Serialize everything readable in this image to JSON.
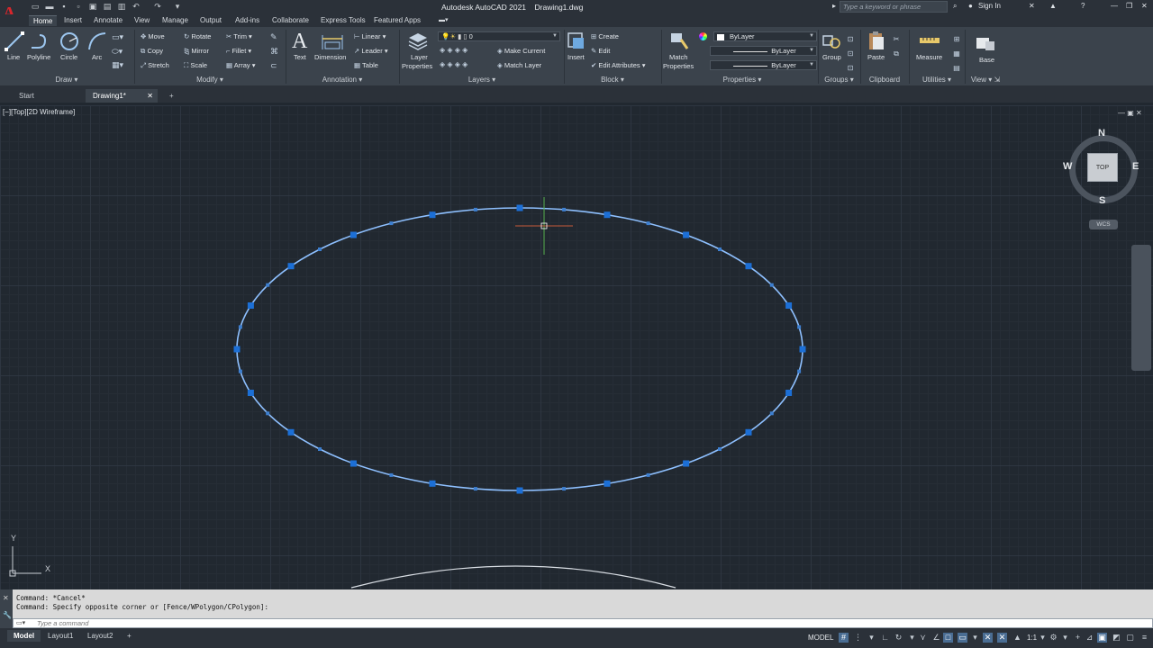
{
  "app": {
    "title": "Autodesk AutoCAD 2021",
    "file": "Drawing1.dwg",
    "logo": "A",
    "search_placeholder": "Type a keyword or phrase",
    "sign_in": "Sign In"
  },
  "ribbon_tabs": [
    "Home",
    "Insert",
    "Annotate",
    "View",
    "Manage",
    "Output",
    "Add-ins",
    "Collaborate",
    "Express Tools",
    "Featured Apps"
  ],
  "draw": {
    "title": "Draw",
    "line": "Line",
    "polyline": "Polyline",
    "circle": "Circle",
    "arc": "Arc"
  },
  "modify": {
    "title": "Modify",
    "move": "Move",
    "rotate": "Rotate",
    "trim": "Trim",
    "copy": "Copy",
    "mirror": "Mirror",
    "fillet": "Fillet",
    "stretch": "Stretch",
    "scale": "Scale",
    "array": "Array"
  },
  "annotation": {
    "title": "Annotation",
    "text": "Text",
    "dimension": "Dimension",
    "linear": "Linear",
    "leader": "Leader",
    "table": "Table"
  },
  "layers": {
    "title": "Layers",
    "layer_properties_1": "Layer",
    "layer_properties_2": "Properties",
    "current_layer": "0",
    "make_current": "Make Current",
    "match_layer": "Match Layer"
  },
  "block": {
    "title": "Block",
    "insert": "Insert",
    "create": "Create",
    "edit": "Edit",
    "edit_attributes": "Edit Attributes"
  },
  "properties": {
    "title": "Properties",
    "match_1": "Match",
    "match_2": "Properties",
    "color": "ByLayer",
    "linetype": "ByLayer",
    "lineweight": "ByLayer"
  },
  "groups": {
    "title": "Groups",
    "group": "Group"
  },
  "clipboard": {
    "title": "Clipboard",
    "paste": "Paste"
  },
  "utilities": {
    "title": "Utilities",
    "measure": "Measure"
  },
  "view_panel": {
    "title": "View",
    "base": "Base"
  },
  "doc_tabs": [
    "Start",
    "Drawing1*"
  ],
  "viewport_label": "[−][Top][2D Wireframe]",
  "viewcube": {
    "face": "TOP",
    "n": "N",
    "s": "S",
    "e": "E",
    "w": "W",
    "wcs": "WCS"
  },
  "ucs": {
    "x": "X",
    "y": "Y"
  },
  "command": {
    "history": [
      "Command: *Cancel*",
      "Command: Specify opposite corner or [Fence/WPolygon/CPolygon]:"
    ],
    "placeholder": "Type a command"
  },
  "layout_tabs": [
    "Model",
    "Layout1",
    "Layout2"
  ],
  "status": {
    "model": "MODEL",
    "scale": "1:1"
  },
  "colors": {
    "accent": "#4a9eff",
    "canvas": "#212830",
    "grips": "#1c6fd6"
  }
}
